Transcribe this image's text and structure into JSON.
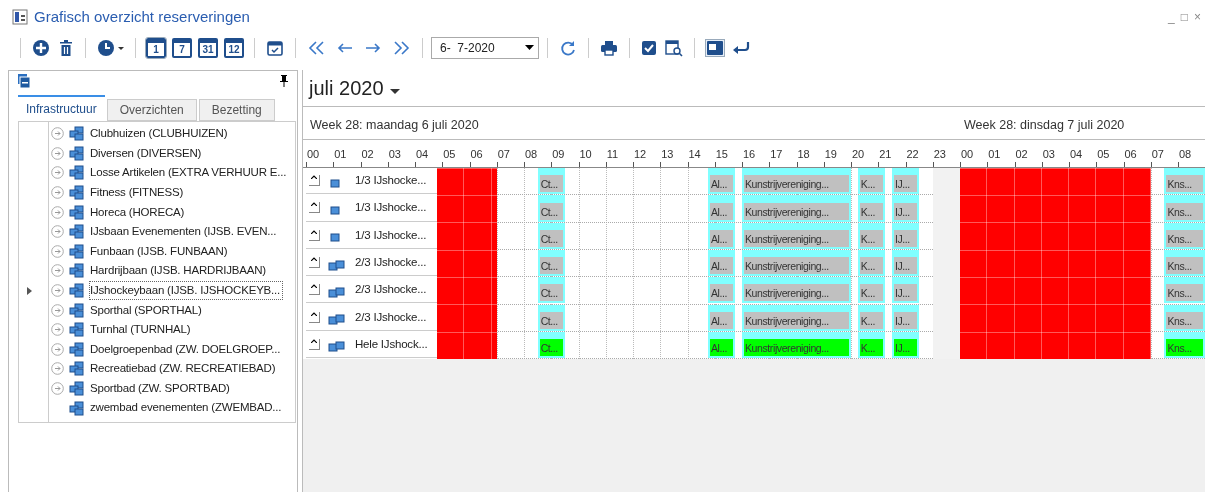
{
  "window": {
    "title": "Grafisch overzicht reserveringen",
    "controls": [
      "_",
      "□",
      "×"
    ]
  },
  "toolbar": {
    "day_views": [
      {
        "label": "1",
        "selected": true
      },
      {
        "label": "7",
        "selected": false
      },
      {
        "label": "31",
        "selected": false
      },
      {
        "label": "12",
        "selected": false
      }
    ],
    "date": "6-  7-2020",
    "layout_toggle_on": true
  },
  "left_panel": {
    "tabs": [
      {
        "label": "Infrastructuur",
        "selected": true
      },
      {
        "label": "Overzichten",
        "selected": false
      },
      {
        "label": "Bezetting",
        "selected": false
      }
    ],
    "tree": [
      {
        "label": "Clubhuizen (CLUBHUIZEN)",
        "expandable": true,
        "selected": false
      },
      {
        "label": "Diversen (DIVERSEN)",
        "expandable": true,
        "selected": false
      },
      {
        "label": "Losse Artikelen (EXTRA VERHUUR E...",
        "expandable": true,
        "selected": false
      },
      {
        "label": "Fitness (FITNESS)",
        "expandable": true,
        "selected": false
      },
      {
        "label": "Horeca (HORECA)",
        "expandable": true,
        "selected": false
      },
      {
        "label": "IJsbaan Evenementen (IJSB. EVEN...",
        "expandable": true,
        "selected": false
      },
      {
        "label": "Funbaan (IJSB. FUNBAAN)",
        "expandable": true,
        "selected": false
      },
      {
        "label": "Hardrijbaan (IJSB. HARDRIJBAAN)",
        "expandable": true,
        "selected": false
      },
      {
        "label": "IJshockeybaan (IJSB. IJSHOCKEYB...",
        "expandable": true,
        "selected": true
      },
      {
        "label": "Sporthal (SPORTHAL)",
        "expandable": true,
        "selected": false
      },
      {
        "label": "Turnhal (TURNHAL)",
        "expandable": true,
        "selected": false
      },
      {
        "label": "Doelgroepenbad (ZW. DOELGROEP...",
        "expandable": true,
        "selected": false
      },
      {
        "label": "Recreatiebad (ZW. RECREATIEBAD)",
        "expandable": true,
        "selected": false
      },
      {
        "label": "Sportbad (ZW. SPORTBAD)",
        "expandable": true,
        "selected": false
      },
      {
        "label": "zwembad evenementen (ZWEMBAD...",
        "expandable": false,
        "selected": false
      }
    ]
  },
  "gantt": {
    "month": "juli 2020",
    "days": [
      "Week 28: maandag 6 juli 2020",
      "Week 28: dinsdag 7 juli 2020"
    ],
    "hours": [
      "00",
      "01",
      "02",
      "03",
      "04",
      "05",
      "06",
      "07",
      "08",
      "09",
      "10",
      "11",
      "12",
      "13",
      "14",
      "15",
      "16",
      "17",
      "18",
      "19",
      "20",
      "21",
      "22",
      "23",
      "00",
      "01",
      "02",
      "03",
      "04",
      "05",
      "06",
      "07",
      "08"
    ],
    "unavailable": [
      {
        "kind": "blocked"
      },
      {
        "kind": "off"
      },
      {
        "kind": "blocked"
      }
    ],
    "rows": [
      {
        "label": "1/3 IJshocke...",
        "kind": "single",
        "bookings": [
          {
            "text": "Ct...",
            "color": "#c0c0c0"
          },
          {
            "text": "Al...",
            "color": "#c0c0c0"
          },
          {
            "text": "Kunstrijvereniging...",
            "color": "#c0c0c0"
          },
          {
            "text": "K...",
            "color": "#c0c0c0"
          },
          {
            "text": "IJ...",
            "color": "#c0c0c0"
          },
          {
            "text": "Kns...",
            "color": "#c0c0c0"
          }
        ]
      },
      {
        "label": "1/3 IJshocke...",
        "kind": "single",
        "bookings": [
          {
            "text": "Ct...",
            "color": "#c0c0c0"
          },
          {
            "text": "Al...",
            "color": "#c0c0c0"
          },
          {
            "text": "Kunstrijvereniging...",
            "color": "#c0c0c0"
          },
          {
            "text": "K...",
            "color": "#c0c0c0"
          },
          {
            "text": "IJ...",
            "color": "#c0c0c0"
          },
          {
            "text": "Kns...",
            "color": "#c0c0c0"
          }
        ]
      },
      {
        "label": "1/3 IJshocke...",
        "kind": "single",
        "bookings": [
          {
            "text": "Ct...",
            "color": "#c0c0c0"
          },
          {
            "text": "Al...",
            "color": "#c0c0c0"
          },
          {
            "text": "Kunstrijvereniging...",
            "color": "#c0c0c0"
          },
          {
            "text": "K...",
            "color": "#c0c0c0"
          },
          {
            "text": "IJ...",
            "color": "#c0c0c0"
          },
          {
            "text": "Kns...",
            "color": "#c0c0c0"
          }
        ]
      },
      {
        "label": "2/3 IJshocke...",
        "kind": "double",
        "bookings": [
          {
            "text": "Ct...",
            "color": "#c0c0c0"
          },
          {
            "text": "Al...",
            "color": "#c0c0c0"
          },
          {
            "text": "Kunstrijvereniging...",
            "color": "#c0c0c0"
          },
          {
            "text": "K...",
            "color": "#c0c0c0"
          },
          {
            "text": "IJ...",
            "color": "#c0c0c0"
          },
          {
            "text": "Kns...",
            "color": "#c0c0c0"
          }
        ]
      },
      {
        "label": "2/3 IJshocke...",
        "kind": "double",
        "bookings": [
          {
            "text": "Ct...",
            "color": "#c0c0c0"
          },
          {
            "text": "Al...",
            "color": "#c0c0c0"
          },
          {
            "text": "Kunstrijvereniging...",
            "color": "#c0c0c0"
          },
          {
            "text": "K...",
            "color": "#c0c0c0"
          },
          {
            "text": "IJ...",
            "color": "#c0c0c0"
          },
          {
            "text": "Kns...",
            "color": "#c0c0c0"
          }
        ]
      },
      {
        "label": "2/3 IJshocke...",
        "kind": "double",
        "bookings": [
          {
            "text": "Ct...",
            "color": "#c0c0c0"
          },
          {
            "text": "Al...",
            "color": "#c0c0c0"
          },
          {
            "text": "Kunstrijvereniging...",
            "color": "#c0c0c0"
          },
          {
            "text": "K...",
            "color": "#c0c0c0"
          },
          {
            "text": "IJ...",
            "color": "#c0c0c0"
          },
          {
            "text": "Kns...",
            "color": "#c0c0c0"
          }
        ]
      },
      {
        "label": "Hele IJshock...",
        "kind": "double",
        "bookings": [
          {
            "text": "Ct...",
            "color": "#00ff00"
          },
          {
            "text": "Al...",
            "color": "#00ff00"
          },
          {
            "text": "Kunstrijvereniging...",
            "color": "#00ff00"
          },
          {
            "text": "K...",
            "color": "#00ff00"
          },
          {
            "text": "IJ...",
            "color": "#00ff00"
          },
          {
            "text": "Kns...",
            "color": "#00ff00"
          }
        ]
      }
    ]
  }
}
